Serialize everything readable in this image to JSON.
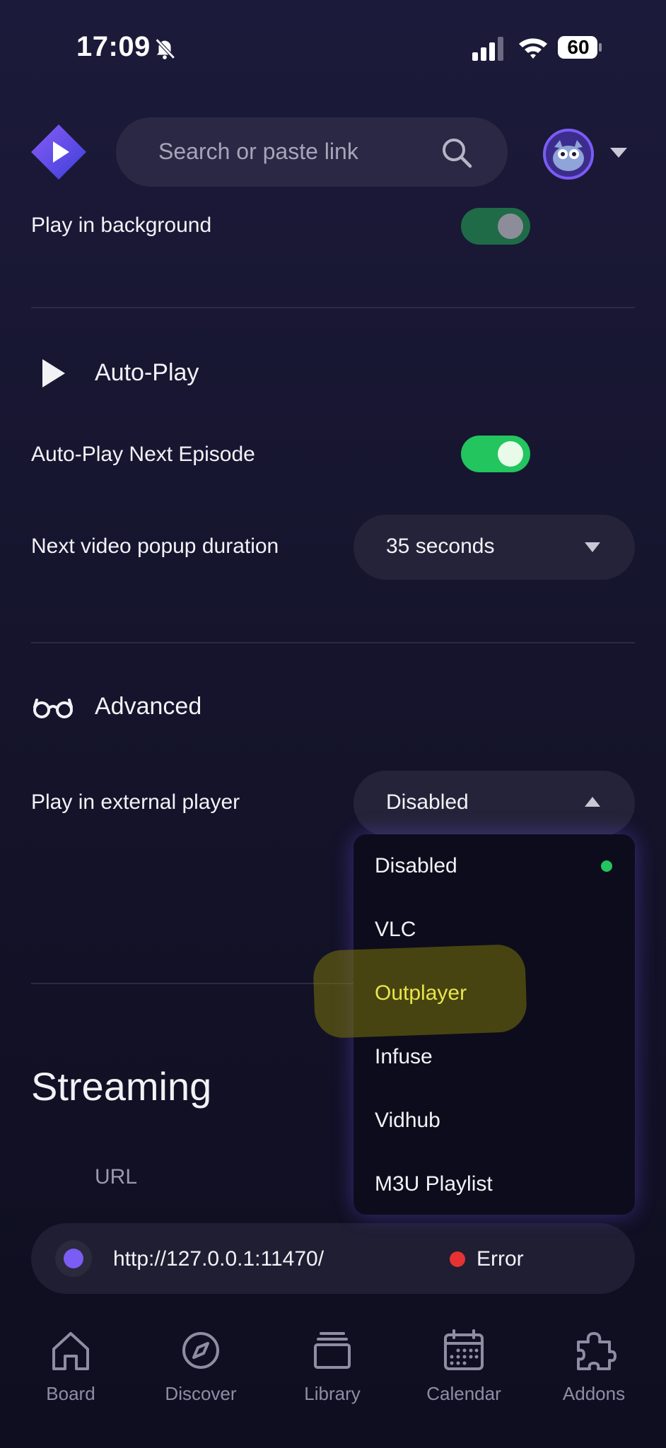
{
  "status_bar": {
    "time": "17:09",
    "battery": "60"
  },
  "header": {
    "search_placeholder": "Search or paste link"
  },
  "player": {
    "play_in_background_label": "Play in background",
    "autoplay_section_title": "Auto-Play",
    "autoplay_next_label": "Auto-Play Next Episode",
    "next_popup_label": "Next video popup duration",
    "next_popup_value": "35 seconds"
  },
  "advanced": {
    "section_title": "Advanced",
    "external_player_label": "Play in external player",
    "external_player_value": "Disabled",
    "options": [
      "Disabled",
      "VLC",
      "Outplayer",
      "Infuse",
      "Vidhub",
      "M3U Playlist"
    ],
    "selected_option": "Disabled",
    "highlighted_option": "Outplayer"
  },
  "streaming": {
    "title": "Streaming",
    "url_header": "URL",
    "url": "http://127.0.0.1:11470/",
    "status": "Error"
  },
  "bottom_nav": [
    {
      "label": "Board",
      "icon": "home-icon"
    },
    {
      "label": "Discover",
      "icon": "compass-icon"
    },
    {
      "label": "Library",
      "icon": "library-icon"
    },
    {
      "label": "Calendar",
      "icon": "calendar-icon"
    },
    {
      "label": "Addons",
      "icon": "puzzle-icon"
    }
  ],
  "colors": {
    "accent": "#7b5cf5",
    "toggle_on": "#22c55e",
    "error": "#e63232",
    "highlight": "#e8e54a"
  }
}
